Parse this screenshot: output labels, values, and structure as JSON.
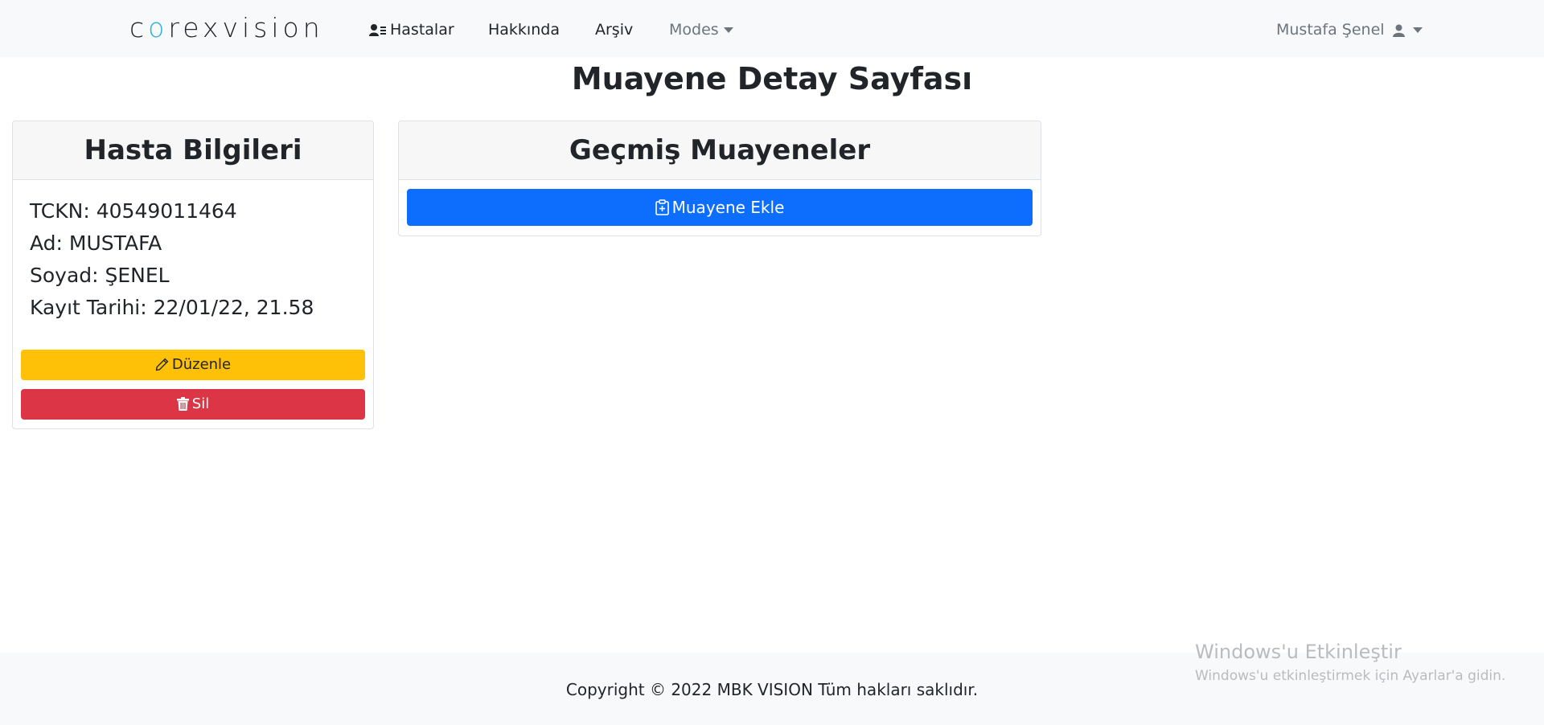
{
  "navbar": {
    "brand": {
      "part1": "c",
      "o": "o",
      "part2": "rexvision"
    },
    "links": {
      "patients": "Hastalar",
      "about": "Hakkında",
      "archive": "Arşiv",
      "modes": "Modes"
    },
    "user": "Mustafa Şenel"
  },
  "page": {
    "title": "Muayene Detay Sayfası"
  },
  "patient_card": {
    "header": "Hasta Bilgileri",
    "tckn": "TCKN: 40549011464",
    "name": "Ad: MUSTAFA",
    "surname": "Soyad: ŞENEL",
    "registered": "Kayıt Tarihi: 22/01/22, 21.58",
    "edit_label": "Düzenle",
    "delete_label": "Sil"
  },
  "history_card": {
    "header": "Geçmiş Muayeneler",
    "add_label": "Muayene Ekle"
  },
  "windows": {
    "activate_title": "Windows'u Etkinleştir",
    "activate_sub": "Windows'u etkinleştirmek için Ayarlar'a gidin."
  },
  "footer": {
    "copyright": "Copyright © 2022 MBK VISION Tüm hakları saklıdır."
  },
  "colors": {
    "warning": "#ffc107",
    "danger": "#dc3545",
    "primary": "#0d6efd",
    "navbar_bg": "#f8f9fa"
  }
}
